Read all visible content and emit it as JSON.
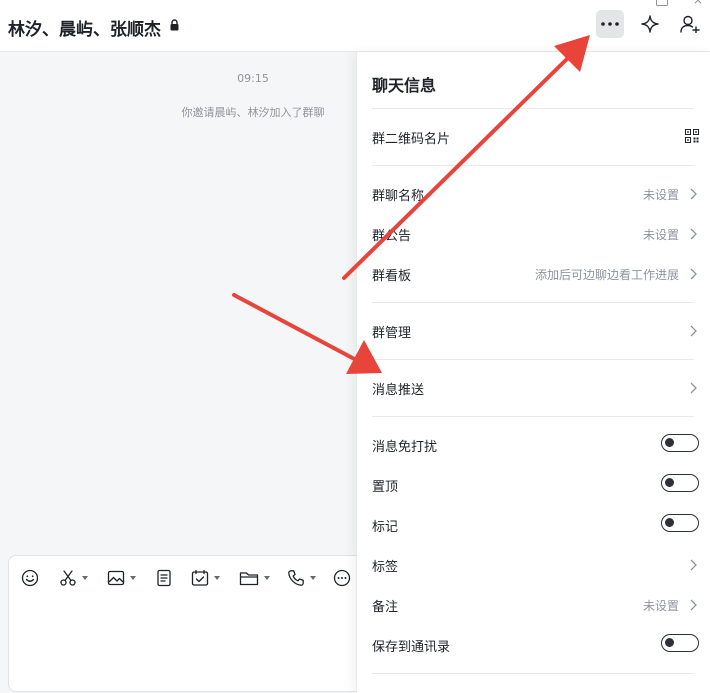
{
  "header": {
    "chat_title": "林汐、晨屿、张顺杰",
    "icons": [
      "lock-icon",
      "more-icon",
      "sparkle-icon",
      "add-user-icon"
    ]
  },
  "window": {
    "controls": [
      "maximize-icon",
      "close-icon"
    ],
    "close_glyph": "×"
  },
  "chat": {
    "time": "09:15",
    "system_message": "你邀请晨屿、林汐加入了群聊"
  },
  "composer": {
    "tools": [
      "emoji-icon",
      "scissors-icon",
      "image-icon",
      "doc-icon",
      "task-icon",
      "folder-icon",
      "phone-icon",
      "more-circle-icon"
    ]
  },
  "panel": {
    "title": "聊天信息",
    "qr_label": "群二维码名片",
    "group_name_label": "群聊名称",
    "group_name_value": "未设置",
    "announcement_label": "群公告",
    "announcement_value": "未设置",
    "board_label": "群看板",
    "board_value": "添加后可边聊边看工作进展",
    "manage_label": "群管理",
    "push_label": "消息推送",
    "dnd_label": "消息免打扰",
    "dnd_on": false,
    "pin_label": "置顶",
    "pin_on": false,
    "mark_label": "标记",
    "mark_on": false,
    "tag_label": "标签",
    "note_label": "备注",
    "note_value": "未设置",
    "save_contacts_label": "保存到通讯录",
    "save_contacts_on": false
  },
  "annotation": {
    "arrow_color": "#e8443a"
  }
}
